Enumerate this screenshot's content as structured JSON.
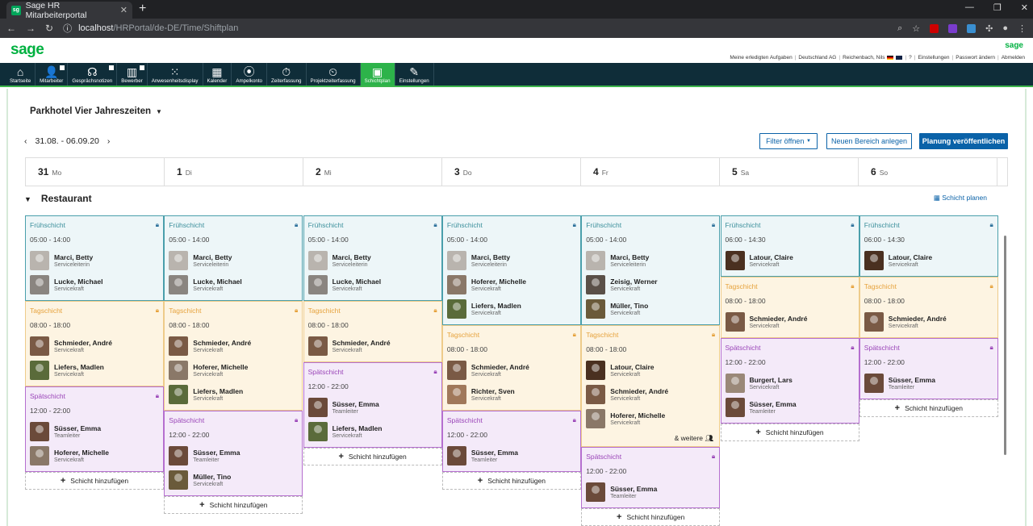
{
  "browser": {
    "tab_title": "Sage HR Mitarbeiterportal",
    "url_host": "localhost",
    "url_path": "/HRPortal/de-DE/Time/Shiftplan"
  },
  "header": {
    "logo": "sage",
    "logo_right": "sage",
    "links": [
      "Meine erledigten Aufgaben",
      "Deutschland AG",
      "Reichenbach, Nils",
      "Einstellungen",
      "Passwort ändern",
      "Abmelden"
    ]
  },
  "nav": [
    {
      "label": "Startseite",
      "icon": "home-icon",
      "glyph": "⌂"
    },
    {
      "label": "Mitarbeiter",
      "icon": "user-icon",
      "glyph": "👤"
    },
    {
      "label": "Gesprächsnotizen",
      "icon": "chat-icon",
      "glyph": "☊"
    },
    {
      "label": "Bewerber",
      "icon": "applicant-icon",
      "glyph": "▥"
    },
    {
      "label": "Anwesenheitsdisplay",
      "icon": "grid-icon",
      "glyph": "⁙"
    },
    {
      "label": "Kalender",
      "icon": "calendar-icon",
      "glyph": "▦"
    },
    {
      "label": "Ampelkonto",
      "icon": "traffic-light-icon",
      "glyph": "⦿"
    },
    {
      "label": "Zeiterfassung",
      "icon": "time-tracking-icon",
      "glyph": "⏱"
    },
    {
      "label": "Projektzeiterfassung",
      "icon": "project-time-icon",
      "glyph": "⏲"
    },
    {
      "label": "Schichtplan",
      "icon": "shiftplan-icon",
      "glyph": "▣"
    },
    {
      "label": "Einstellungen",
      "icon": "wrench-icon",
      "glyph": "✎"
    }
  ],
  "page": {
    "location": "Parkhotel Vier Jahreszeiten",
    "date_range": "31.08. - 06.09.20",
    "filter_button": "Filter öffnen",
    "new_area_button": "Neuen Bereich anlegen",
    "publish_button": "Planung veröffentlichen",
    "section_title": "Restaurant",
    "plan_shift_link": "Schicht planen",
    "add_shift_label": "Schicht hinzufügen",
    "more_label": "& weitere"
  },
  "days": [
    {
      "num": "31",
      "wd": "Mo"
    },
    {
      "num": "1",
      "wd": "Di"
    },
    {
      "num": "2",
      "wd": "Mi"
    },
    {
      "num": "3",
      "wd": "Do"
    },
    {
      "num": "4",
      "wd": "Fr"
    },
    {
      "num": "5",
      "wd": "Sa"
    },
    {
      "num": "6",
      "wd": "So"
    }
  ],
  "columns": [
    {
      "shifts": [
        {
          "type": "frueh",
          "name": "Frühschicht",
          "time": "05:00 - 14:00",
          "people": [
            {
              "name": "Marci, Betty",
              "role": "Serviceleiterin",
              "color": "#b9b4ae"
            },
            {
              "name": "Lucke, Michael",
              "role": "Servicekraft",
              "color": "#8a8580"
            }
          ]
        },
        {
          "type": "tag",
          "name": "Tagschicht",
          "time": "08:00 - 18:00",
          "people": [
            {
              "name": "Schmieder, André",
              "role": "Servicekraft",
              "color": "#7a5a45"
            },
            {
              "name": "Liefers, Madlen",
              "role": "Servicekraft",
              "color": "#5a6b3a"
            }
          ]
        },
        {
          "type": "spaet",
          "name": "Spätschicht",
          "time": "12:00 - 22:00",
          "people": [
            {
              "name": "Süsser, Emma",
              "role": "Teamleiter",
              "color": "#6b4a3a"
            },
            {
              "name": "Hoferer, Michelle",
              "role": "Servicekraft",
              "color": "#8a7868"
            }
          ]
        }
      ]
    },
    {
      "shifts": [
        {
          "type": "frueh",
          "name": "Frühschicht",
          "time": "05:00 - 14:00",
          "people": [
            {
              "name": "Marci, Betty",
              "role": "Serviceleiterin",
              "color": "#b9b4ae"
            },
            {
              "name": "Lucke, Michael",
              "role": "Servicekraft",
              "color": "#8a8580"
            }
          ]
        },
        {
          "type": "tag",
          "name": "Tagschicht",
          "time": "08:00 - 18:00",
          "people": [
            {
              "name": "Schmieder, André",
              "role": "Servicekraft",
              "color": "#7a5a45"
            },
            {
              "name": "Hoferer, Michelle",
              "role": "Servicekraft",
              "color": "#8a7868"
            },
            {
              "name": "Liefers, Madlen",
              "role": "Servicekraft",
              "color": "#5a6b3a"
            }
          ]
        },
        {
          "type": "spaet",
          "name": "Spätschicht",
          "time": "12:00 - 22:00",
          "people": [
            {
              "name": "Süsser, Emma",
              "role": "Teamleiter",
              "color": "#6b4a3a"
            },
            {
              "name": "Müller, Tino",
              "role": "Servicekraft",
              "color": "#6a5a3a"
            }
          ]
        }
      ]
    },
    {
      "shifts": [
        {
          "type": "frueh",
          "name": "Frühschicht",
          "time": "05:00 - 14:00",
          "people": [
            {
              "name": "Marci, Betty",
              "role": "Serviceleiterin",
              "color": "#b9b4ae"
            },
            {
              "name": "Lucke, Michael",
              "role": "Servicekraft",
              "color": "#8a8580"
            }
          ]
        },
        {
          "type": "tag",
          "name": "Tagschicht",
          "time": "08:00 - 18:00",
          "people": [
            {
              "name": "Schmieder, André",
              "role": "Servicekraft",
              "color": "#7a5a45"
            }
          ]
        },
        {
          "type": "spaet",
          "name": "Spätschicht",
          "time": "12:00 - 22:00",
          "people": [
            {
              "name": "Süsser, Emma",
              "role": "Teamleiter",
              "color": "#6b4a3a"
            },
            {
              "name": "Liefers, Madlen",
              "role": "Servicekraft",
              "color": "#5a6b3a"
            }
          ]
        }
      ]
    },
    {
      "shifts": [
        {
          "type": "frueh",
          "name": "Frühschicht",
          "time": "05:00 - 14:00",
          "people": [
            {
              "name": "Marci, Betty",
              "role": "Serviceleiterin",
              "color": "#b9b4ae"
            },
            {
              "name": "Hoferer, Michelle",
              "role": "Servicekraft",
              "color": "#8a7868"
            },
            {
              "name": "Liefers, Madlen",
              "role": "Servicekraft",
              "color": "#5a6b3a"
            }
          ]
        },
        {
          "type": "tag",
          "name": "Tagschicht",
          "time": "08:00 - 18:00",
          "people": [
            {
              "name": "Schmieder, André",
              "role": "Servicekraft",
              "color": "#7a5a45"
            },
            {
              "name": "Richter, Sven",
              "role": "Servicekraft",
              "color": "#a0785a"
            }
          ]
        },
        {
          "type": "spaet",
          "name": "Spätschicht",
          "time": "12:00 - 22:00",
          "people": [
            {
              "name": "Süsser, Emma",
              "role": "Teamleiter",
              "color": "#6b4a3a"
            }
          ]
        }
      ]
    },
    {
      "shifts": [
        {
          "type": "frueh",
          "name": "Frühschicht",
          "time": "05:00 - 14:00",
          "people": [
            {
              "name": "Marci, Betty",
              "role": "Serviceleiterin",
              "color": "#b9b4ae"
            },
            {
              "name": "Zeisig, Werner",
              "role": "Servicekraft",
              "color": "#5a5048"
            },
            {
              "name": "Müller, Tino",
              "role": "Servicekraft",
              "color": "#6a5a3a"
            }
          ]
        },
        {
          "type": "tag",
          "name": "Tagschicht",
          "time": "08:00 - 18:00",
          "more": true,
          "people": [
            {
              "name": "Latour, Claire",
              "role": "Servicekraft",
              "color": "#4a3020"
            },
            {
              "name": "Schmieder, André",
              "role": "Servicekraft",
              "color": "#7a5a45"
            },
            {
              "name": "Hoferer, Michelle",
              "role": "Servicekraft",
              "color": "#8a7868"
            }
          ]
        },
        {
          "type": "spaet",
          "name": "Spätschicht",
          "time": "12:00 - 22:00",
          "people": [
            {
              "name": "Süsser, Emma",
              "role": "Teamleiter",
              "color": "#6b4a3a"
            }
          ]
        }
      ]
    },
    {
      "shifts": [
        {
          "type": "frueh",
          "name": "Frühschicht",
          "time": "06:00 - 14:30",
          "people": [
            {
              "name": "Latour, Claire",
              "role": "Servicekraft",
              "color": "#4a3020"
            }
          ]
        },
        {
          "type": "tag",
          "name": "Tagschicht",
          "time": "08:00 - 18:00",
          "people": [
            {
              "name": "Schmieder, André",
              "role": "Servicekraft",
              "color": "#7a5a45"
            }
          ]
        },
        {
          "type": "spaet",
          "name": "Spätschicht",
          "time": "12:00 - 22:00",
          "people": [
            {
              "name": "Burgert, Lars",
              "role": "Servicekraft",
              "color": "#9a8878"
            },
            {
              "name": "Süsser, Emma",
              "role": "Teamleiter",
              "color": "#6b4a3a"
            }
          ]
        }
      ]
    },
    {
      "shifts": [
        {
          "type": "frueh",
          "name": "Frühschicht",
          "time": "06:00 - 14:30",
          "people": [
            {
              "name": "Latour, Claire",
              "role": "Servicekraft",
              "color": "#4a3020"
            }
          ]
        },
        {
          "type": "tag",
          "name": "Tagschicht",
          "time": "08:00 - 18:00",
          "people": [
            {
              "name": "Schmieder, André",
              "role": "Servicekraft",
              "color": "#7a5a45"
            }
          ]
        },
        {
          "type": "spaet",
          "name": "Spätschicht",
          "time": "12:00 - 22:00",
          "people": [
            {
              "name": "Süsser, Emma",
              "role": "Teamleiter",
              "color": "#6b4a3a"
            }
          ]
        }
      ]
    }
  ]
}
